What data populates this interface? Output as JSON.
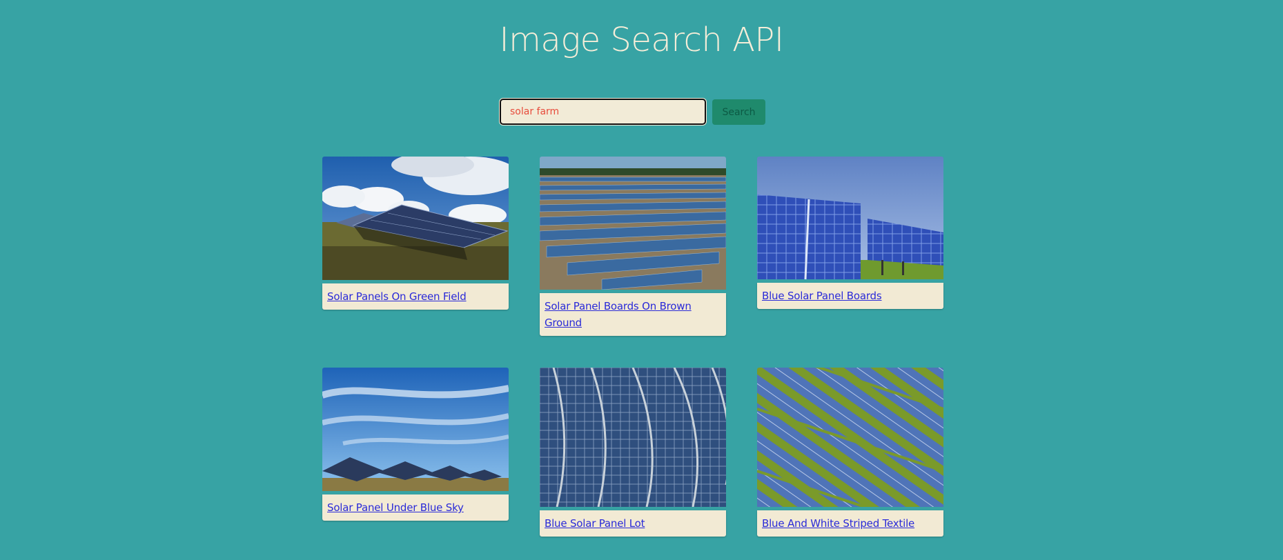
{
  "header": {
    "title": "Image Search API"
  },
  "search": {
    "value": "solar farm",
    "button_label": "Search"
  },
  "results": [
    {
      "caption": "Solar Panels On Green Field",
      "image": "solar-panels-green-field-photo"
    },
    {
      "caption": "Solar Panel Boards On Brown Ground",
      "image": "solar-panel-boards-brown-ground-photo"
    },
    {
      "caption": "Blue Solar Panel Boards",
      "image": "blue-solar-panel-boards-photo"
    },
    {
      "caption": "Solar Panel Under Blue Sky",
      "image": "solar-panel-blue-sky-photo"
    },
    {
      "caption": "Blue Solar Panel Lot",
      "image": "blue-solar-panel-lot-photo"
    },
    {
      "caption": "Blue And White Striped Textile",
      "image": "blue-white-striped-textile-photo"
    }
  ],
  "colors": {
    "background": "#37a3a4",
    "title": "#f5edd8",
    "input_bg": "#f2ebd7",
    "input_text": "#e74c3c",
    "button_bg": "#1f8a6c",
    "caption_bg": "#f2ead4",
    "link": "#2a2ad8"
  }
}
